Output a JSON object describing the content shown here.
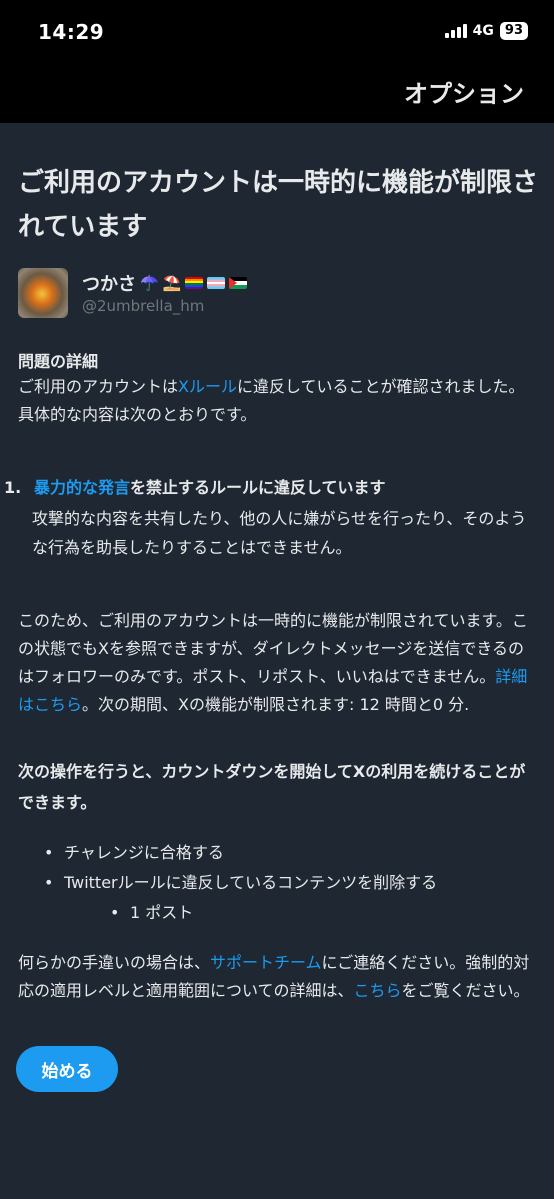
{
  "status": {
    "time": "14:29",
    "network": "4G",
    "battery": "93"
  },
  "header": {
    "options_label": "オプション"
  },
  "title": "ご利用のアカウントは一時的に機能が制限されています",
  "user": {
    "display_name": "つかさ",
    "emoji_umbrella": "☂️",
    "emoji_beach": "⛱️",
    "handle": "@2umbrella_hm",
    "flags": [
      "rainbow-flag-icon",
      "trans-flag-icon",
      "palestine-flag-icon"
    ]
  },
  "details": {
    "heading": "問題の詳細",
    "intro_before": "ご利用のアカウントは",
    "intro_link": "Xルール",
    "intro_after": "に違反していることが確認されました。具体的な内容は次のとおりです。"
  },
  "violation": {
    "number": "1.",
    "link": "暴力的な発言",
    "title_after": "を禁止するルールに違反しています",
    "description": "攻撃的な内容を共有したり、他の人に嫌がらせを行ったり、そのような行為を助長したりすることはできません。"
  },
  "restriction": {
    "before": "このため、ご利用のアカウントは一時的に機能が制限されています。この状態でもXを参照できますが、ダイレクトメッセージを送信できるのはフォロワーのみです。ポスト、リポスト、いいねはできません。",
    "link": "詳細はこちら",
    "after": "。次の期間、Xの機能が制限されます: 12 時間と0 分."
  },
  "action_heading": "次の操作を行うと、カウントダウンを開始してXの利用を続けることができます。",
  "steps": [
    "チャレンジに合格する",
    "Twitterルールに違反しているコンテンツを削除する",
    "1 ポスト"
  ],
  "support": {
    "before": "何らかの手違いの場合は、",
    "link1": "サポートチーム",
    "middle": "にご連絡ください。強制的対応の適用レベルと適用範囲についての詳細は、",
    "link2": "こちら",
    "after": "をご覧ください。"
  },
  "start_button": "始める",
  "colors": {
    "background": "#1e2732",
    "topbar": "#000000",
    "accent": "#1d9bf0",
    "muted": "#71767b"
  }
}
